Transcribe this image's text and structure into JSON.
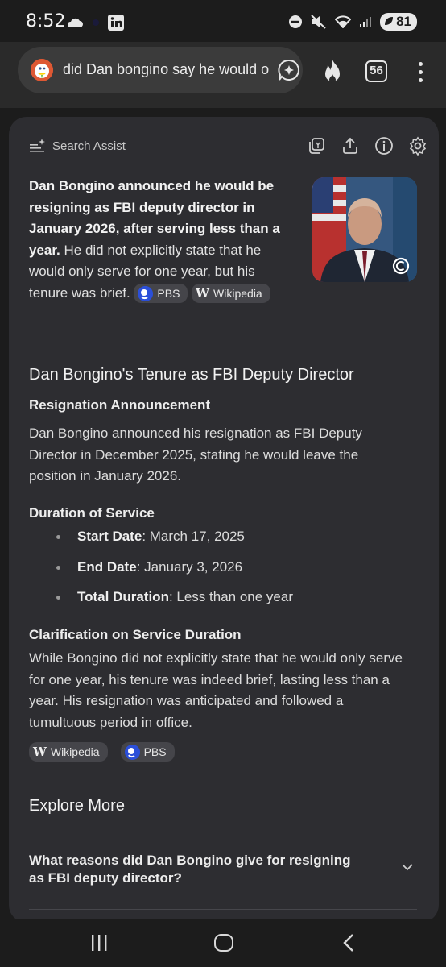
{
  "status_bar": {
    "time": "8:52",
    "battery": "81",
    "icons": [
      "cloud-icon",
      "linkedin-icon",
      "dnd-icon",
      "mute-icon",
      "wifi-icon",
      "signal-icon",
      "battery-icon"
    ]
  },
  "browser": {
    "url_text": "did Dan bongino say he would o",
    "tab_count": "56"
  },
  "search_assist": {
    "title": "Search Assist",
    "summary_bold": "Dan Bongino announced he would be resigning as FBI deputy director in January 2026, after serving less than a year.",
    "summary_rest": " He did not explicitly state that he would only serve for one year, but his tenure was brief.",
    "summary_chips": [
      {
        "label": "PBS",
        "icon": "pbs-icon"
      },
      {
        "label": "Wikipedia",
        "icon": "wikipedia-icon"
      }
    ]
  },
  "article": {
    "heading": "Dan Bongino's Tenure as FBI Deputy Director",
    "section1_title": "Resignation Announcement",
    "section1_text": "Dan Bongino announced his resignation as FBI Deputy Director in December 2025, stating he would leave the position in January 2026.",
    "section2_title": "Duration of Service",
    "bullets": [
      {
        "label": "Start Date",
        "value": ": March 17, 2025"
      },
      {
        "label": "End Date",
        "value": ": January 3, 2026"
      },
      {
        "label": "Total Duration",
        "value": ": Less than one year"
      }
    ],
    "section3_title": "Clarification on Service Duration",
    "section3_text": "While Bongino did not explicitly state that he would only serve for one year, his tenure was indeed brief, lasting less than a year. His resignation was anticipated and followed a tumultuous period in office.",
    "source_chips": [
      {
        "label": "Wikipedia",
        "icon": "wikipedia-icon"
      },
      {
        "label": "PBS",
        "icon": "pbs-icon"
      }
    ]
  },
  "explore": {
    "title": "Explore More",
    "question": "What reasons did Dan Bongino give for resigning as FBI deputy director?"
  },
  "colors": {
    "background": "#1c1c1c",
    "card": "#2d2d31",
    "chip": "#45454a",
    "pbs_blue": "#2b4fd9",
    "ddg_orange": "#de5833"
  }
}
